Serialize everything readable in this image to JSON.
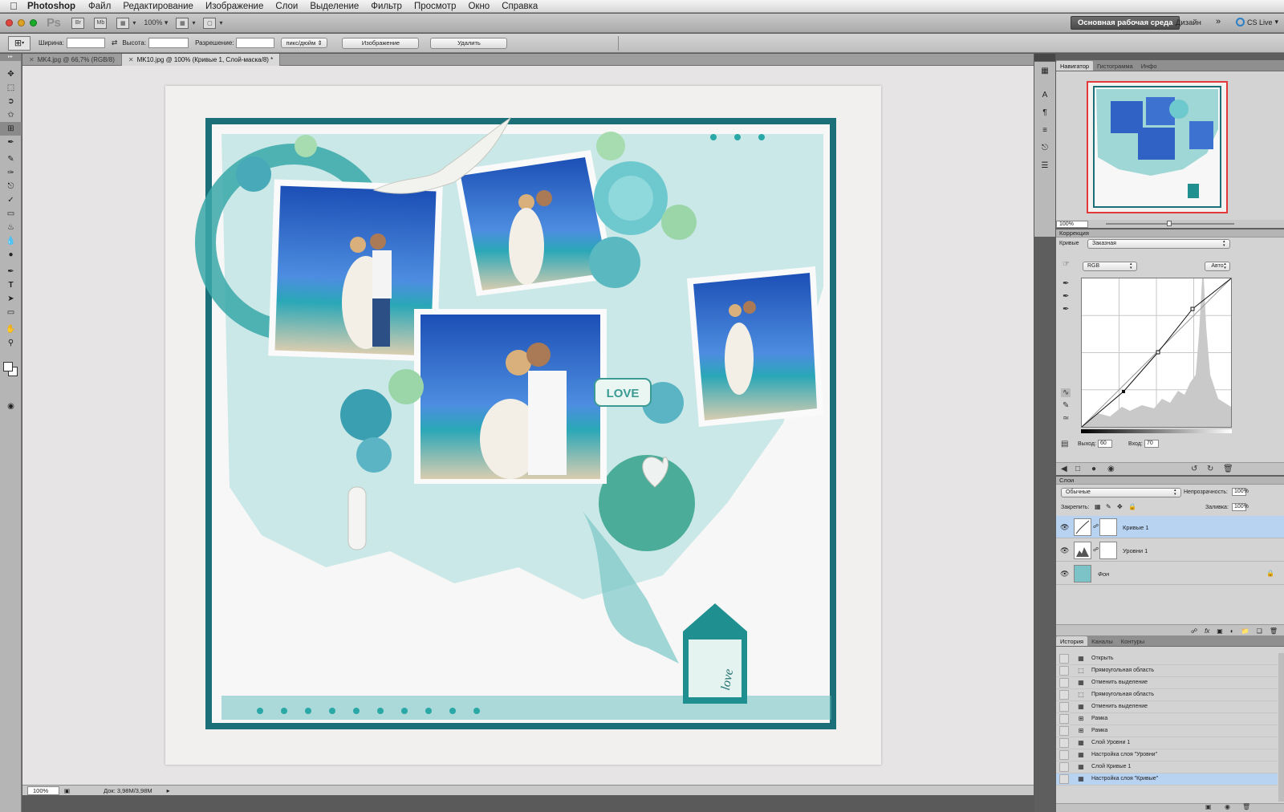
{
  "menubar": {
    "app": "Photoshop",
    "items": [
      "Файл",
      "Редактирование",
      "Изображение",
      "Слои",
      "Выделение",
      "Фильтр",
      "Просмотр",
      "Окно",
      "Справка"
    ]
  },
  "appbar": {
    "logo": "Ps",
    "zoom": "100%",
    "workspace_active": "Основная рабочая среда",
    "workspace_design": "Дизайн",
    "more": "»",
    "cslive": "CS Live"
  },
  "options": {
    "width_label": "Ширина:",
    "height_label": "Высота:",
    "resolution_label": "Разрешение:",
    "units": "пикс/дюйм",
    "image_button": "Изображение",
    "delete_button": "Удалить"
  },
  "tabs": [
    {
      "label": "MK4.jpg @ 66,7% (RGB/8)"
    },
    {
      "label": "MK10.jpg @ 100% (Кривые 1, Слой-маска/8) *"
    }
  ],
  "status": {
    "zoom": "100%",
    "doc": "Док: 3,98M/3,98M"
  },
  "navigator": {
    "tabs": [
      "Навигатор",
      "Гистограмма",
      "Инфо"
    ],
    "zoom": "100%"
  },
  "correction": {
    "title": "Коррекция",
    "preset_label": "Кривые",
    "preset_value": "Заказная",
    "channel": "RGB",
    "auto_button": "Авто",
    "output_label": "Выход:",
    "output_value": "60",
    "input_label": "Вход:",
    "input_value": "70"
  },
  "layers": {
    "title": "Слои",
    "blend_mode": "Обычные",
    "opacity_label": "Непрозрачность:",
    "opacity_value": "100%",
    "lock_label": "Закрепить:",
    "fill_label": "Заливка:",
    "fill_value": "100%",
    "items": [
      {
        "name": "Кривые 1"
      },
      {
        "name": "Уровни 1"
      },
      {
        "name": "Фон"
      }
    ]
  },
  "history": {
    "tabs": [
      "История",
      "Каналы",
      "Контуры"
    ],
    "items": [
      "Открыть",
      "Прямоугольная область",
      "Отменить выделение",
      "Прямоугольная область",
      "Отменить выделение",
      "Рамка",
      "Рамка",
      "Слой Уровни 1",
      "Настройка слоя \"Уровни\"",
      "Слой Кривые 1",
      "Настройка слоя \"Кривые\""
    ]
  },
  "canvas_artwork": {
    "labels": [
      "LOVE",
      "love"
    ]
  },
  "colors": {
    "accent_blue": "#2b7fc7",
    "selection": "#b8d2f2",
    "navigator_frame": "#e23a3a",
    "teal": "#2aa7a7"
  }
}
